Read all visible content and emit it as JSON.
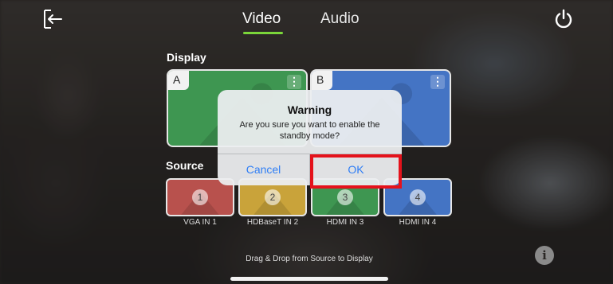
{
  "header": {
    "back_icon": "exit-arrow-icon",
    "tabs": [
      {
        "label": "Video",
        "active": true
      },
      {
        "label": "Audio",
        "active": false
      }
    ],
    "power_icon": "power-icon",
    "active_tab_color": "#7bd63a"
  },
  "display": {
    "label": "Display",
    "cards": [
      {
        "letter": "A",
        "color": "#3e9651",
        "menu_icon": "kebab-menu-icon"
      },
      {
        "letter": "B",
        "color": "#4474c4",
        "menu_icon": "kebab-menu-icon"
      }
    ]
  },
  "source": {
    "label": "Source",
    "items": [
      {
        "number": "1",
        "name": "VGA IN 1",
        "color": "#b8514d"
      },
      {
        "number": "2",
        "name": "HDBaseT IN 2",
        "color": "#c9a33a"
      },
      {
        "number": "3",
        "name": "HDMI IN 3",
        "color": "#3e9651"
      },
      {
        "number": "4",
        "name": "HDMI IN 4",
        "color": "#4474c4"
      }
    ]
  },
  "hint": "Drag & Drop from Source to Display",
  "info_icon": "info-icon",
  "dialog": {
    "title": "Warning",
    "message": "Are you sure you want to enable the standby mode?",
    "cancel_label": "Cancel",
    "ok_label": "OK",
    "button_color": "#2f7ef5"
  },
  "highlight_color": "#e4121b"
}
